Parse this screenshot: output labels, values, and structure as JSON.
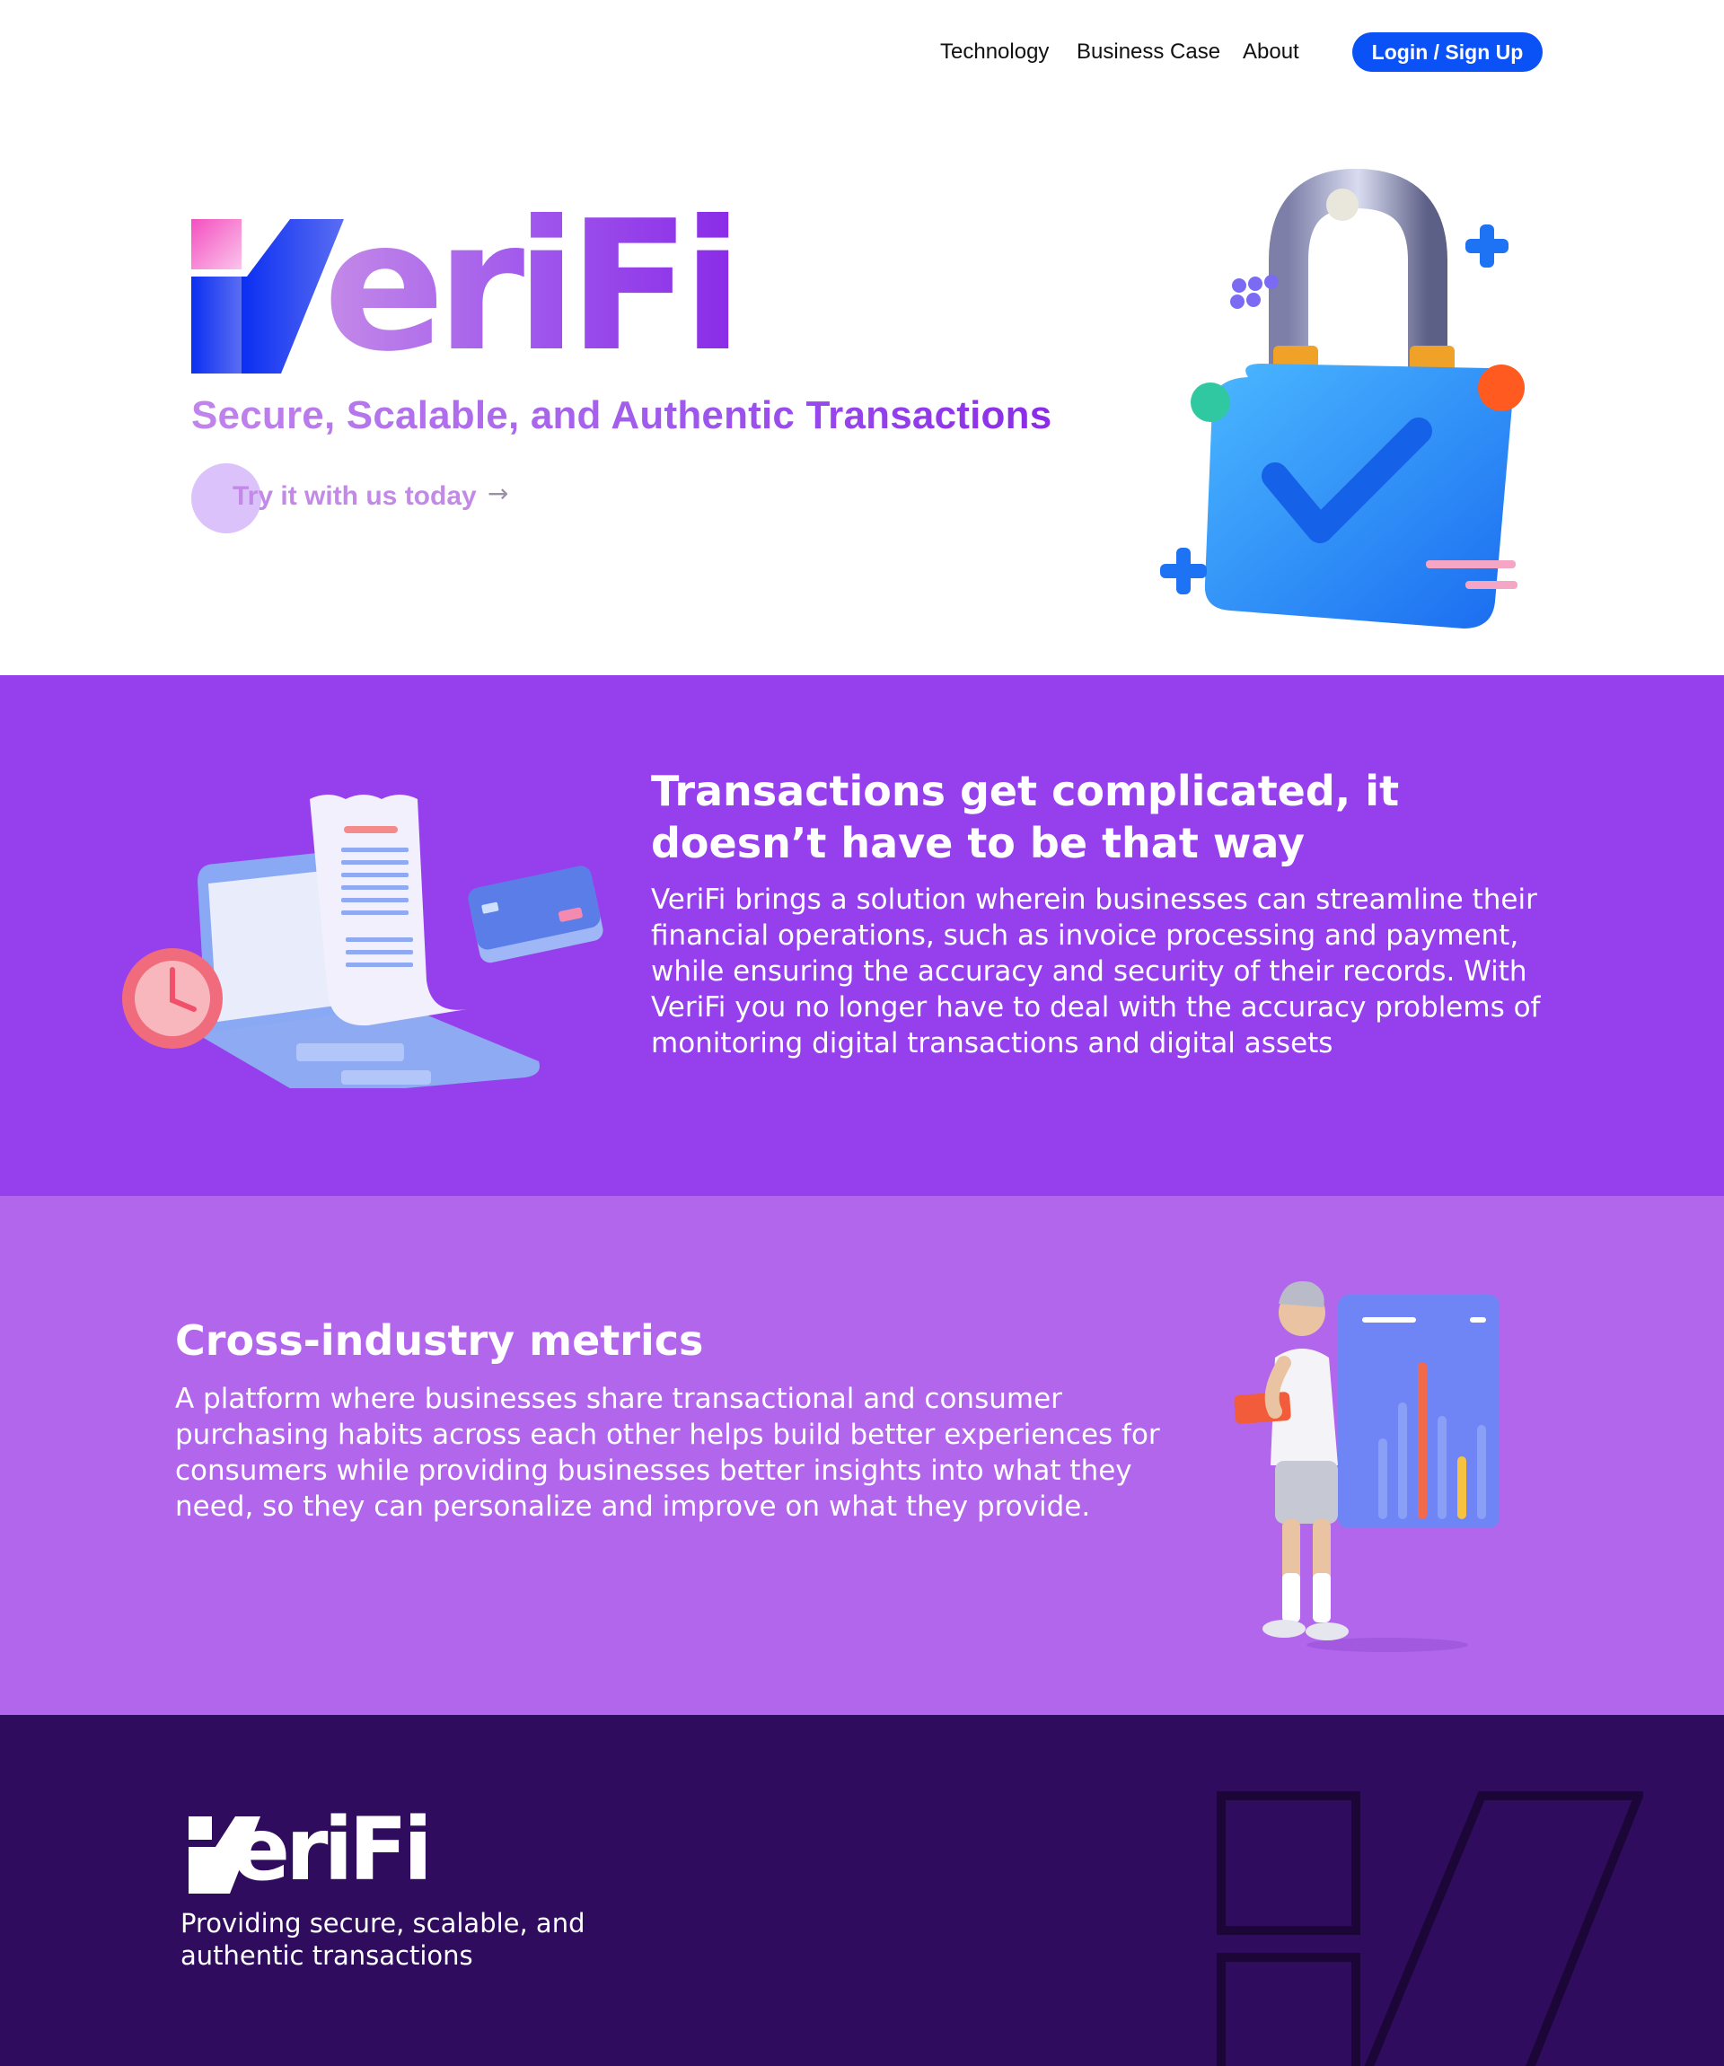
{
  "nav": {
    "links": [
      "Technology",
      "Business Case",
      "About"
    ],
    "login_label": "Login / Sign Up"
  },
  "hero": {
    "logo_text": "eriFi",
    "tagline": "Secure, Scalable, and Authentic Transactions",
    "cta_label": "Try it with us today",
    "cta_arrow": "→"
  },
  "section_problem": {
    "title": "Transactions get complicated, it doesn’t have to be that way",
    "body": "VeriFi brings a solution wherein businesses can streamline their financial operations, such as invoice processing and payment, while ensuring the accuracy and security of their records. With VeriFi you no longer have to deal with the accuracy problems of monitoring digital transactions and digital assets"
  },
  "section_metrics": {
    "title": "Cross-industry metrics",
    "body": "A platform where businesses share transactional and consumer purchasing habits across each other helps build better experiences for consumers while providing businesses better insights into what they need, so they can personalize and improve on what they provide."
  },
  "footer": {
    "logo_text": "eriFi",
    "tagline": "Providing secure, scalable, and authentic transactions"
  },
  "colors": {
    "brand_blue": "#0a52f5",
    "purple_primary": "#9640ed",
    "purple_light": "#b266ec",
    "footer_bg": "#2f0c5d"
  }
}
